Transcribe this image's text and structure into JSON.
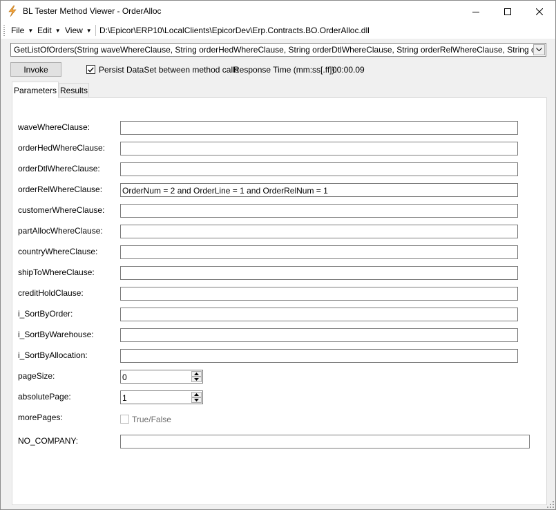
{
  "window": {
    "title": "BL Tester Method Viewer - OrderAlloc",
    "icon": "lightning-app-icon"
  },
  "menubar": {
    "file": "File",
    "edit": "Edit",
    "view": "View",
    "assembly_path": "D:\\Epicor\\ERP10\\LocalClients\\EpicorDev\\Erp.Contracts.BO.OrderAlloc.dll"
  },
  "method_selector": {
    "value": "GetListOfOrders(String waveWhereClause, String orderHedWhereClause, String orderDtlWhereClause, String orderRelWhereClause, String customerWhereClause, String partAllocWhereClause, String countryWhereClause, String shipToWhereClause, String creditHoldClause, Boolean i_SortByOrder, Boolean i_SortByWarehouse, Boolean i_SortByAllocation, Int32 pageSize, Int32 absolutePage, out Boolean morePages)"
  },
  "toolbar": {
    "invoke_label": "Invoke",
    "persist_label": "Persist DataSet between method calls",
    "persist_checked": true,
    "response_time_label": "Response Time (mm:ss[.ff]):",
    "response_time_value": "00:00.09"
  },
  "tabs": [
    {
      "label": "Parameters",
      "active": true
    },
    {
      "label": "Results",
      "active": false
    }
  ],
  "params": {
    "waveWhereClause": {
      "label": "waveWhereClause:",
      "value": ""
    },
    "orderHedWhereClause": {
      "label": "orderHedWhereClause:",
      "value": ""
    },
    "orderDtlWhereClause": {
      "label": "orderDtlWhereClause:",
      "value": ""
    },
    "orderRelWhereClause": {
      "label": "orderRelWhereClause:",
      "value": "OrderNum = 2 and OrderLine = 1 and OrderRelNum = 1"
    },
    "customerWhereClause": {
      "label": "customerWhereClause:",
      "value": ""
    },
    "partAllocWhereClause": {
      "label": "partAllocWhereClause:",
      "value": ""
    },
    "countryWhereClause": {
      "label": "countryWhereClause:",
      "value": ""
    },
    "shipToWhereClause": {
      "label": "shipToWhereClause:",
      "value": ""
    },
    "creditHoldClause": {
      "label": "creditHoldClause:",
      "value": ""
    },
    "i_SortByOrder": {
      "label": "i_SortByOrder:",
      "value": ""
    },
    "i_SortByWarehouse": {
      "label": "i_SortByWarehouse:",
      "value": ""
    },
    "i_SortByAllocation": {
      "label": "i_SortByAllocation:",
      "value": ""
    },
    "pageSize": {
      "label": "pageSize:",
      "value": "0"
    },
    "absolutePage": {
      "label": "absolutePage:",
      "value": "1"
    },
    "morePages": {
      "label": "morePages:",
      "check_label": "True/False",
      "checked": false
    },
    "NO_COMPANY": {
      "label": "NO_COMPANY:",
      "value": ""
    }
  }
}
